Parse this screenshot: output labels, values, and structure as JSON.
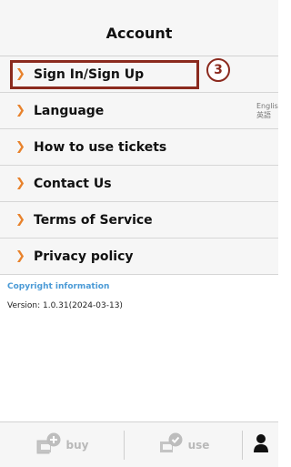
{
  "header": {
    "title": "Account"
  },
  "menu": {
    "items": [
      {
        "label": "Sign In/Sign Up"
      },
      {
        "label": "Language",
        "value_en": "English",
        "value_ja": "英語"
      },
      {
        "label": "How to use tickets"
      },
      {
        "label": "Contact Us"
      },
      {
        "label": "Terms of Service"
      },
      {
        "label": "Privacy policy"
      }
    ],
    "chevron": "❯"
  },
  "annotation": {
    "step": "3",
    "color": "#8b2a1e"
  },
  "info": {
    "copyright": "Copyright information",
    "version": "Version: 1.0.31(2024-03-13)"
  },
  "tabbar": {
    "buy_label": "buy",
    "use_label": "use",
    "icons": [
      "ticket-plus-icon",
      "ticket-check-icon",
      "person-icon"
    ]
  },
  "colors": {
    "accent": "#e8822c",
    "link": "#4a9ad6",
    "highlight": "#8b2a1e"
  }
}
